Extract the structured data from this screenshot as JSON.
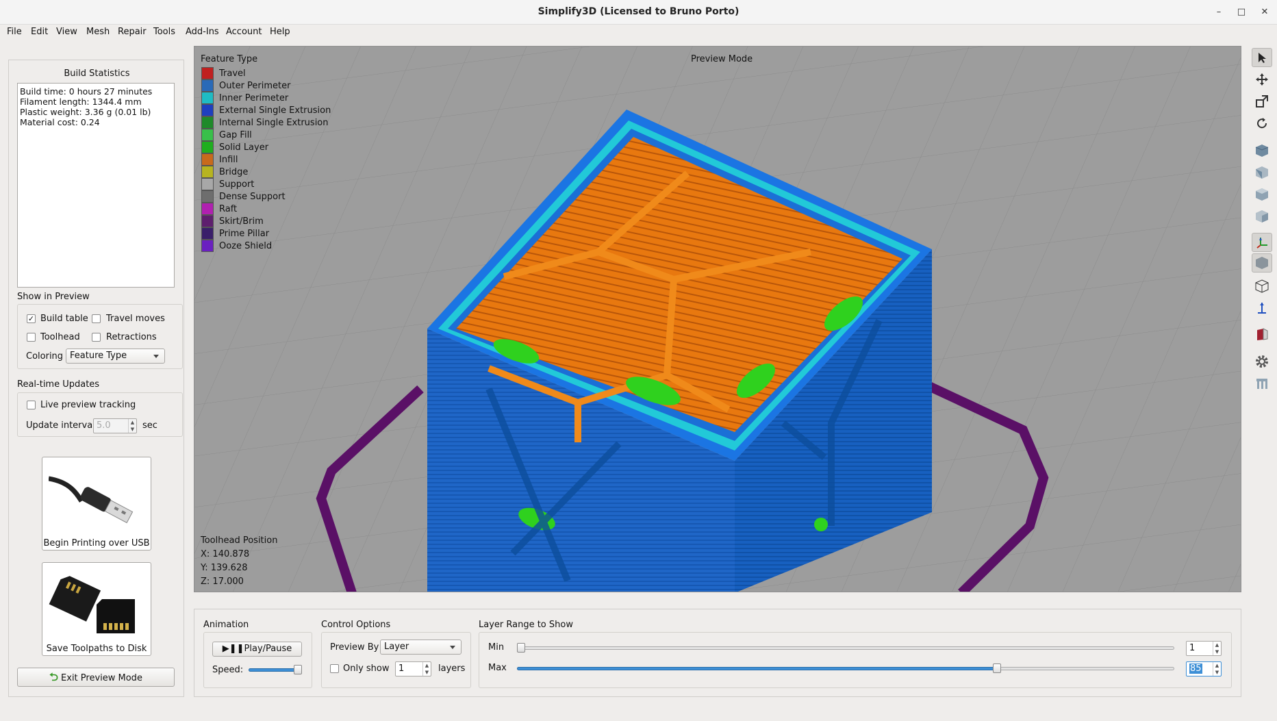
{
  "window": {
    "title": "Simplify3D (Licensed to Bruno Porto)",
    "minimize": "–",
    "maximize": "□",
    "close": "✕"
  },
  "menu": [
    "File",
    "Edit",
    "View",
    "Mesh",
    "Repair",
    "Tools",
    "Add-Ins",
    "Account",
    "Help"
  ],
  "build_stats": {
    "heading": "Build Statistics",
    "lines": [
      "Build time: 0 hours 27 minutes",
      "Filament length: 1344.4 mm",
      "Plastic weight: 3.36 g (0.01 lb)",
      "Material cost: 0.24"
    ]
  },
  "show_in_preview": {
    "heading": "Show in Preview",
    "build_table": "Build table",
    "build_table_checked": true,
    "travel_moves": "Travel moves",
    "toolhead": "Toolhead",
    "retractions": "Retractions",
    "coloring_label": "Coloring",
    "coloring_value": "Feature Type"
  },
  "realtime": {
    "heading": "Real-time Updates",
    "live_tracking": "Live preview tracking",
    "interval_label": "Update interval",
    "interval_value": "5.0",
    "interval_unit": "sec"
  },
  "actions": {
    "usb_label": "Begin Printing over USB",
    "sd_label": "Save Toolpaths to Disk",
    "exit_label": "Exit Preview Mode"
  },
  "viewport": {
    "legend_title": "Feature Type",
    "mode": "Preview Mode",
    "legend": [
      {
        "label": "Travel",
        "color": "#c0201f"
      },
      {
        "label": "Outer Perimeter",
        "color": "#2a6ab8"
      },
      {
        "label": "Inner Perimeter",
        "color": "#1fbcc4"
      },
      {
        "label": "External Single Extrusion",
        "color": "#1f3fbf"
      },
      {
        "label": "Internal Single Extrusion",
        "color": "#1f8a2a"
      },
      {
        "label": "Gap Fill",
        "color": "#38c04a"
      },
      {
        "label": "Solid Layer",
        "color": "#1fae1f"
      },
      {
        "label": "Infill",
        "color": "#c86a1c"
      },
      {
        "label": "Bridge",
        "color": "#b7b420"
      },
      {
        "label": "Support",
        "color": "#a8a8a8"
      },
      {
        "label": "Dense Support",
        "color": "#6e6e6e"
      },
      {
        "label": "Raft",
        "color": "#b020b0"
      },
      {
        "label": "Skirt/Brim",
        "color": "#5e1e6e"
      },
      {
        "label": "Prime Pillar",
        "color": "#3a1e6a"
      },
      {
        "label": "Ooze Shield",
        "color": "#6a20c0"
      }
    ],
    "toolhead": {
      "heading": "Toolhead Position",
      "x": "X: 140.878",
      "y": "Y: 139.628",
      "z": "Z: 17.000"
    }
  },
  "animation": {
    "heading": "Animation",
    "play_label": "Play/Pause",
    "speed_label": "Speed:",
    "speed_level": 1.0
  },
  "control": {
    "heading": "Control Options",
    "preview_by_label": "Preview By",
    "preview_by_value": "Layer",
    "only_show": "Only show",
    "only_show_value": "1",
    "layers": "layers"
  },
  "layer_range": {
    "heading": "Layer Range to Show",
    "min_label": "Min",
    "max_label": "Max",
    "min_value": "1",
    "max_value": "85",
    "max_fraction": 0.73
  }
}
